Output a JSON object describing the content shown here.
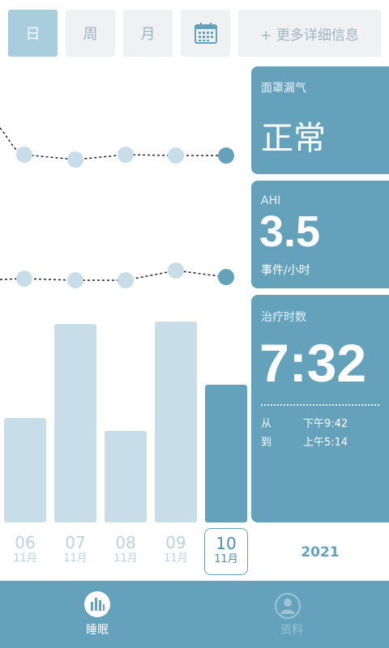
{
  "tabs": [
    {
      "label": "日",
      "active": true
    },
    {
      "label": "周",
      "active": false
    },
    {
      "label": "月",
      "active": false
    }
  ],
  "calendar_icon": "calendar-icon",
  "more_button": "+ 更多详细信息",
  "cards": {
    "leak": {
      "label": "面罩漏气",
      "value": "正常"
    },
    "ahi": {
      "label": "AHI",
      "value": "3.5",
      "unit": "事件/小时"
    },
    "therapy": {
      "label": "治疗时数",
      "value": "7:32",
      "from_label": "从",
      "from_value": "下午9:42",
      "to_label": "到",
      "to_value": "上午5:14"
    }
  },
  "chart_data": {
    "type": "bar",
    "categories": [
      "06",
      "07",
      "08",
      "09",
      "10"
    ],
    "month_label": "11月",
    "values": [
      4.1,
      7.8,
      3.6,
      7.9,
      5.4
    ],
    "ylim": [
      0,
      8.6
    ],
    "selected_index": 4
  },
  "year": "2021",
  "bottom_nav": [
    {
      "label": "睡眠",
      "icon": "sleep-chart-icon",
      "active": true
    },
    {
      "label": "资料",
      "icon": "profile-icon",
      "active": false
    }
  ],
  "colors": {
    "accent": "#64a2bc",
    "light": "#c7dde8",
    "tab_active": "#a8cddd"
  }
}
